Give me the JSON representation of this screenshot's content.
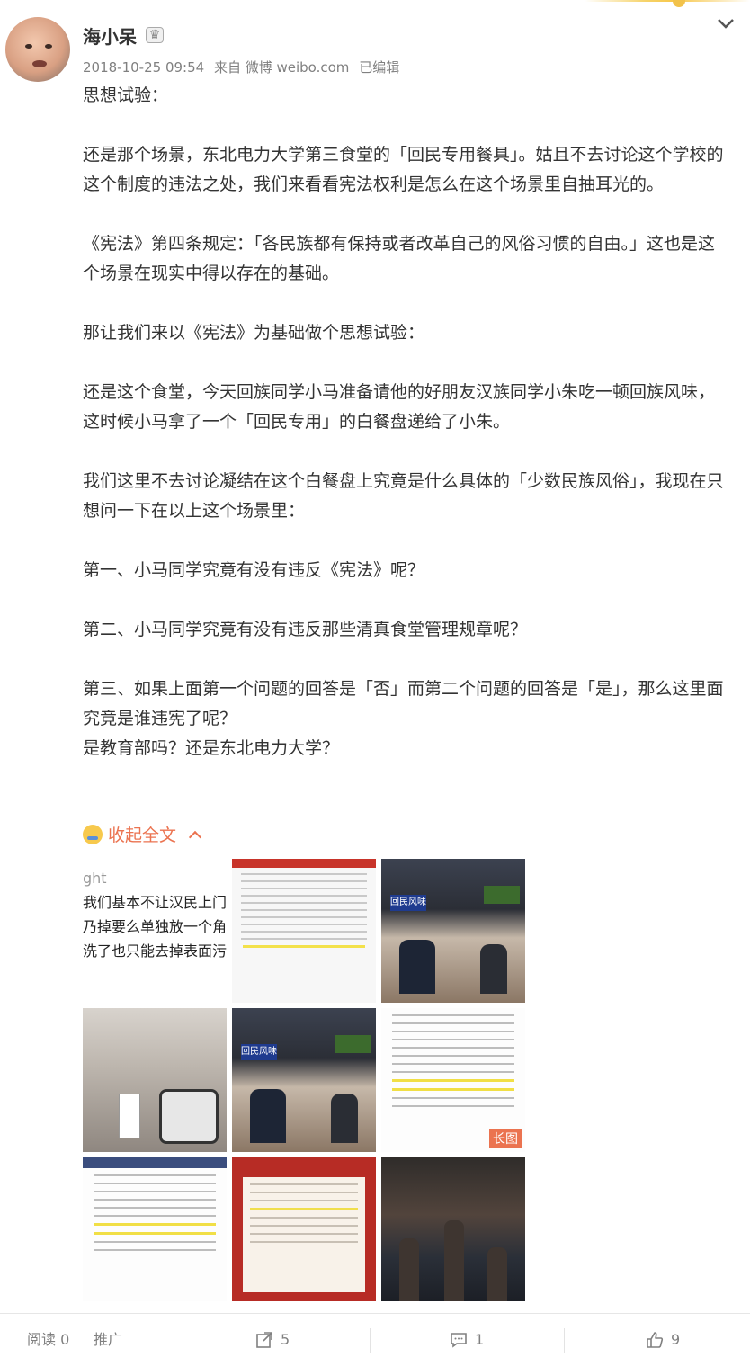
{
  "post": {
    "username": "海小呆",
    "meta": {
      "time": "2018-10-25 09:54",
      "from": "来自 微博 weibo.com",
      "edited": "已编辑"
    },
    "paragraphs": [
      "思想试验：",
      "",
      "还是那个场景，东北电力大学第三食堂的「回民专用餐具」。姑且不去讨论这个学校的这个制度的违法之处，我们来看看宪法权利是怎么在这个场景里自抽耳光的。",
      "",
      "《宪法》第四条规定：「各民族都有保持或者改革自己的风俗习惯的自由。」这也是这个场景在现实中得以存在的基础。",
      "",
      "那让我们来以《宪法》为基础做个思想试验：",
      "",
      "还是这个食堂，今天回族同学小马准备请他的好朋友汉族同学小朱吃一顿回族风味，这时候小马拿了一个「回民专用」的白餐盘递给了小朱。",
      "",
      "我们这里不去讨论凝结在这个白餐盘上究竟是什么具体的「少数民族风俗」，我现在只想问一下在以上这个场景里：",
      "",
      "第一、小马同学究竟有没有违反《宪法》呢？",
      "",
      "第二、小马同学究竟有没有违反那些清真食堂管理规章呢？",
      "",
      "第三、如果上面第一个问题的回答是「否」而第二个问题的回答是「是」，那么这里面究竟是谁违宪了呢？",
      "是教育部吗？还是东北电力大学？"
    ],
    "collapse_label": "收起全文",
    "thumb_text": [
      "ght",
      "我们基本不让汉民上门",
      "乃掉要么单独放一个角",
      "洗了也只能去掉表面污"
    ],
    "long_badge": "长图",
    "shop_sign": "回民风味"
  },
  "footer": {
    "reads": "阅读 0",
    "promote": "推广",
    "reposts": "5",
    "comments": "1",
    "likes": "9"
  }
}
